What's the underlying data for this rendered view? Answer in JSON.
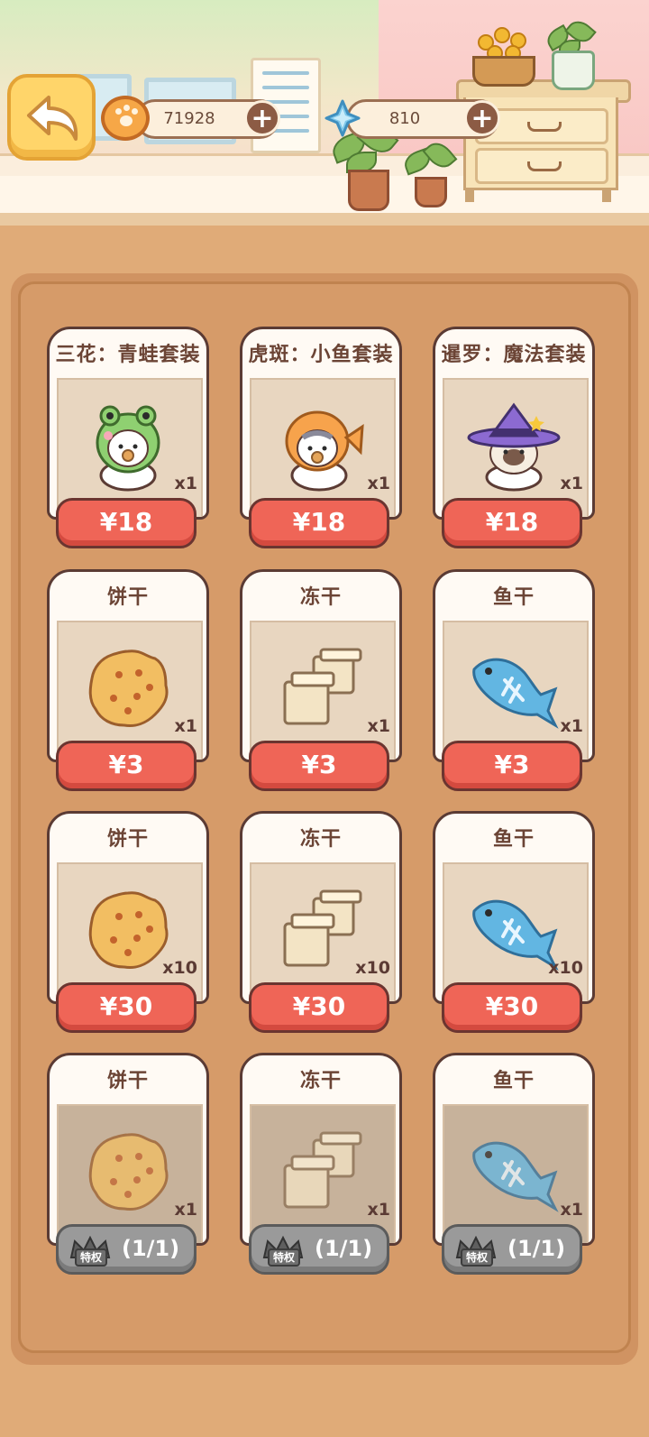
{
  "header": {
    "paw_coins": "71928",
    "gems": "810",
    "plus": "+"
  },
  "shop": {
    "rows": [
      [
        {
          "title": "三花：青蛙套装",
          "qty": "x1",
          "price": "¥18"
        },
        {
          "title": "虎斑：小鱼套装",
          "qty": "x1",
          "price": "¥18"
        },
        {
          "title": "暹罗：魔法套装",
          "qty": "x1",
          "price": "¥18"
        }
      ],
      [
        {
          "title": "饼干",
          "qty": "x1",
          "price": "¥3"
        },
        {
          "title": "冻干",
          "qty": "x1",
          "price": "¥3"
        },
        {
          "title": "鱼干",
          "qty": "x1",
          "price": "¥3"
        }
      ],
      [
        {
          "title": "饼干",
          "qty": "x10",
          "price": "¥30"
        },
        {
          "title": "冻干",
          "qty": "x10",
          "price": "¥30"
        },
        {
          "title": "鱼干",
          "qty": "x10",
          "price": "¥30"
        }
      ],
      [
        {
          "title": "饼干",
          "qty": "x1",
          "privilege": "特权",
          "limit": "(1/1)"
        },
        {
          "title": "冻干",
          "qty": "x1",
          "privilege": "特权",
          "limit": "(1/1)"
        },
        {
          "title": "鱼干",
          "qty": "x1",
          "privilege": "特权",
          "limit": "(1/1)"
        }
      ]
    ]
  },
  "colors": {
    "background": "#e0ab78",
    "price_button": "#ef6557",
    "privilege_button": "#9a9a9a",
    "card_border": "#5b3b34"
  }
}
